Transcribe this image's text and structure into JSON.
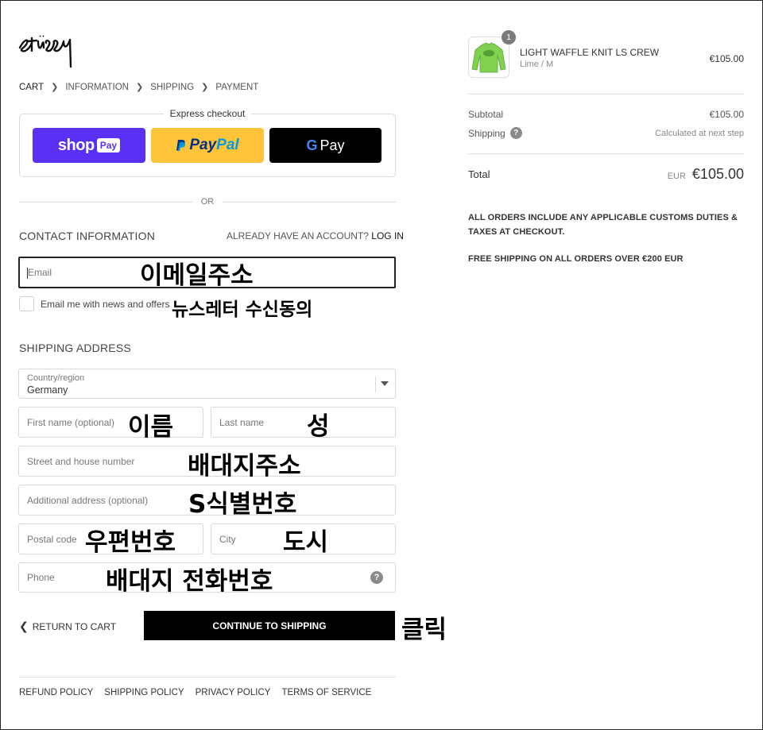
{
  "brand": {
    "logo_text": "Stüssy"
  },
  "breadcrumb": [
    {
      "label": "CART",
      "current": true
    },
    {
      "label": "INFORMATION",
      "current": false
    },
    {
      "label": "SHIPPING",
      "current": false
    },
    {
      "label": "PAYMENT",
      "current": false
    }
  ],
  "express": {
    "title": "Express checkout",
    "shoppay": {
      "shop": "shop",
      "pay": "Pay"
    },
    "paypal": {
      "pay": "Pay",
      "pal": "Pal"
    },
    "gpay": {
      "g": "G",
      "pay": "Pay"
    }
  },
  "divider_or": "OR",
  "contact": {
    "title": "CONTACT INFORMATION",
    "login_prompt": "ALREADY HAVE AN ACCOUNT?",
    "login_link": "LOG IN",
    "email_placeholder": "Email",
    "newsletter_label": "Email me with news and offers"
  },
  "shipping": {
    "title": "SHIPPING ADDRESS",
    "country_label": "Country/region",
    "country_value": "Germany",
    "first_name": "First name (optional)",
    "last_name": "Last name",
    "street": "Street and house number",
    "additional": "Additional address (optional)",
    "postal": "Postal code",
    "city": "City",
    "phone": "Phone"
  },
  "actions": {
    "return_label": "RETURN TO CART",
    "continue_label": "CONTINUE TO SHIPPING"
  },
  "footer": [
    "REFUND POLICY",
    "SHIPPING POLICY",
    "PRIVACY POLICY",
    "TERMS OF SERVICE"
  ],
  "annotations": {
    "email": "이메일주소",
    "newsletter": "뉴스레터 수신동의",
    "first_name": "이름",
    "last_name": "성",
    "street": "배대지주소",
    "additional": "S식별번호",
    "postal": "우편번호",
    "city": "도시",
    "phone": "배대지 전화번호",
    "continue": "클릭"
  },
  "order": {
    "item": {
      "name": "LIGHT WAFFLE KNIT LS CREW",
      "variant": "Lime / M",
      "price": "€105.00",
      "quantity": "1"
    },
    "subtotal_label": "Subtotal",
    "subtotal_value": "€105.00",
    "shipping_label": "Shipping",
    "shipping_value": "Calculated at next step",
    "total_label": "Total",
    "total_currency": "EUR",
    "total_value": "€105.00",
    "notice_1": "ALL ORDERS INCLUDE ANY APPLICABLE CUSTOMS DUTIES & TAXES AT CHECKOUT.",
    "notice_2": "FREE SHIPPING ON ALL ORDERS OVER €200 EUR"
  },
  "colors": {
    "shoppay": "#5a31f4",
    "paypal": "#ffc439",
    "gpay": "#000000",
    "product": "#7fd14f"
  }
}
